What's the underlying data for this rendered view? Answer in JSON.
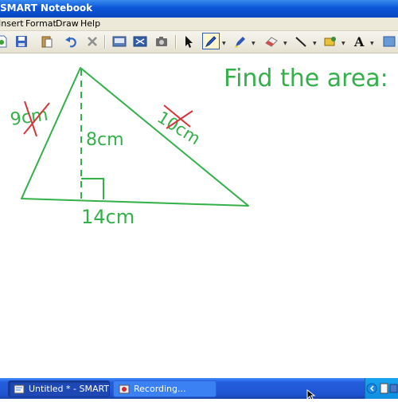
{
  "window": {
    "title": "SMART Notebook"
  },
  "menu": {
    "items": [
      "Insert",
      "Format",
      "Draw",
      "Help"
    ]
  },
  "toolbar": {
    "tools": [
      "new-page-icon",
      "save-icon",
      "paste-icon",
      "undo-icon",
      "delete-icon",
      "screen-shade-icon",
      "full-screen-icon",
      "capture-icon",
      "select-icon",
      "pen-icon",
      "highlighter-icon",
      "eraser-icon",
      "line-icon",
      "fill-icon",
      "text-icon",
      "more-icon"
    ],
    "selected_tool": "pen-icon"
  },
  "canvas": {
    "heading": "Find the area:",
    "left_side_label": "9cm",
    "right_side_label": "10cm",
    "height_label": "8cm",
    "base_label": "14cm",
    "ink_color": "#33b04a",
    "strike_color": "#d8343a"
  },
  "taskbar": {
    "tasks": [
      {
        "label": "Untitled * - SMART N...",
        "state": "active",
        "icon": "smart-notebook-icon"
      },
      {
        "label": "Recording...",
        "state": "inactive",
        "icon": "recorder-icon"
      }
    ]
  }
}
